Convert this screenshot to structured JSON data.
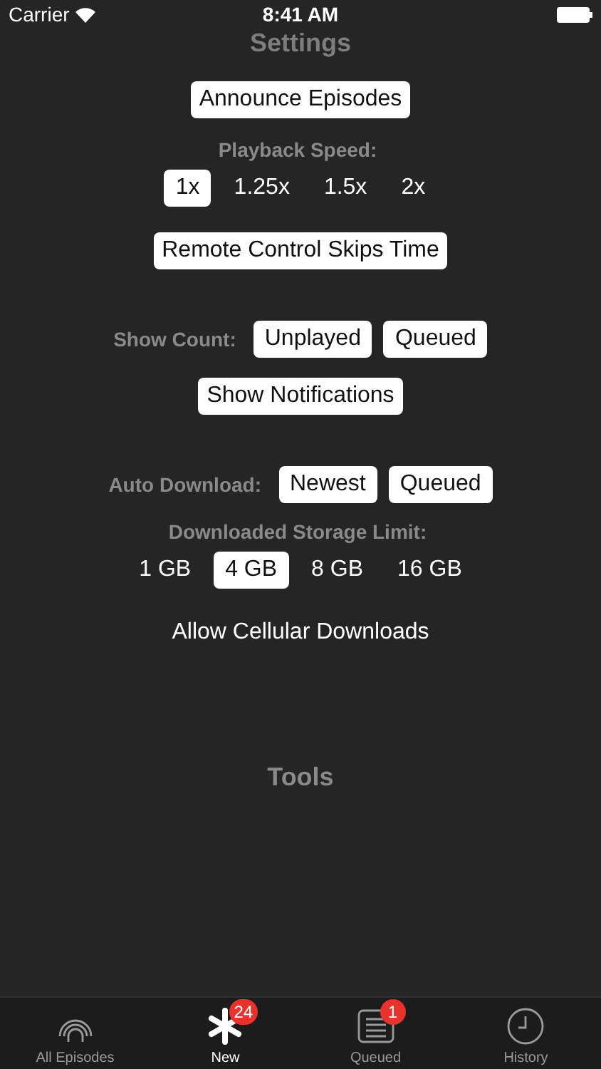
{
  "status_bar": {
    "carrier": "Carrier",
    "time": "8:41 AM"
  },
  "title": "Settings",
  "settings": [
    {
      "kind": "toggle",
      "label": "Announce Episodes",
      "on": true
    },
    {
      "kind": "stacked",
      "label": "Playback Speed:",
      "options": [
        {
          "label": "1x",
          "selected": true
        },
        {
          "label": "1.25x",
          "selected": false
        },
        {
          "label": "1.5x",
          "selected": false
        },
        {
          "label": "2x",
          "selected": false
        }
      ]
    },
    {
      "kind": "toggle",
      "label": "Remote Control Skips Time",
      "on": true
    },
    {
      "kind": "inline",
      "label": "Show Count:",
      "options": [
        {
          "label": "Unplayed",
          "selected": true
        },
        {
          "label": "Queued",
          "selected": true
        }
      ]
    },
    {
      "kind": "toggle",
      "label": "Show Notifications",
      "on": true
    },
    {
      "kind": "inline",
      "label": "Auto Download:",
      "options": [
        {
          "label": "Newest",
          "selected": true
        },
        {
          "label": "Queued",
          "selected": true
        }
      ]
    },
    {
      "kind": "stacked",
      "label": "Downloaded Storage Limit:",
      "options": [
        {
          "label": "1 GB",
          "selected": false
        },
        {
          "label": "4 GB",
          "selected": true
        },
        {
          "label": "8 GB",
          "selected": false
        },
        {
          "label": "16 GB",
          "selected": false
        }
      ]
    },
    {
      "kind": "toggle",
      "label": "Allow Cellular Downloads",
      "on": false
    }
  ],
  "section_heading": "Tools",
  "tabs": [
    {
      "kind": "antenna",
      "label": "All Episodes",
      "selected": false
    },
    {
      "kind": "asterisk",
      "label": "New",
      "selected": true,
      "badge": "24"
    },
    {
      "kind": "list",
      "label": "Queued",
      "selected": false,
      "badge": "1"
    },
    {
      "kind": "clock",
      "label": "History",
      "selected": false
    }
  ]
}
